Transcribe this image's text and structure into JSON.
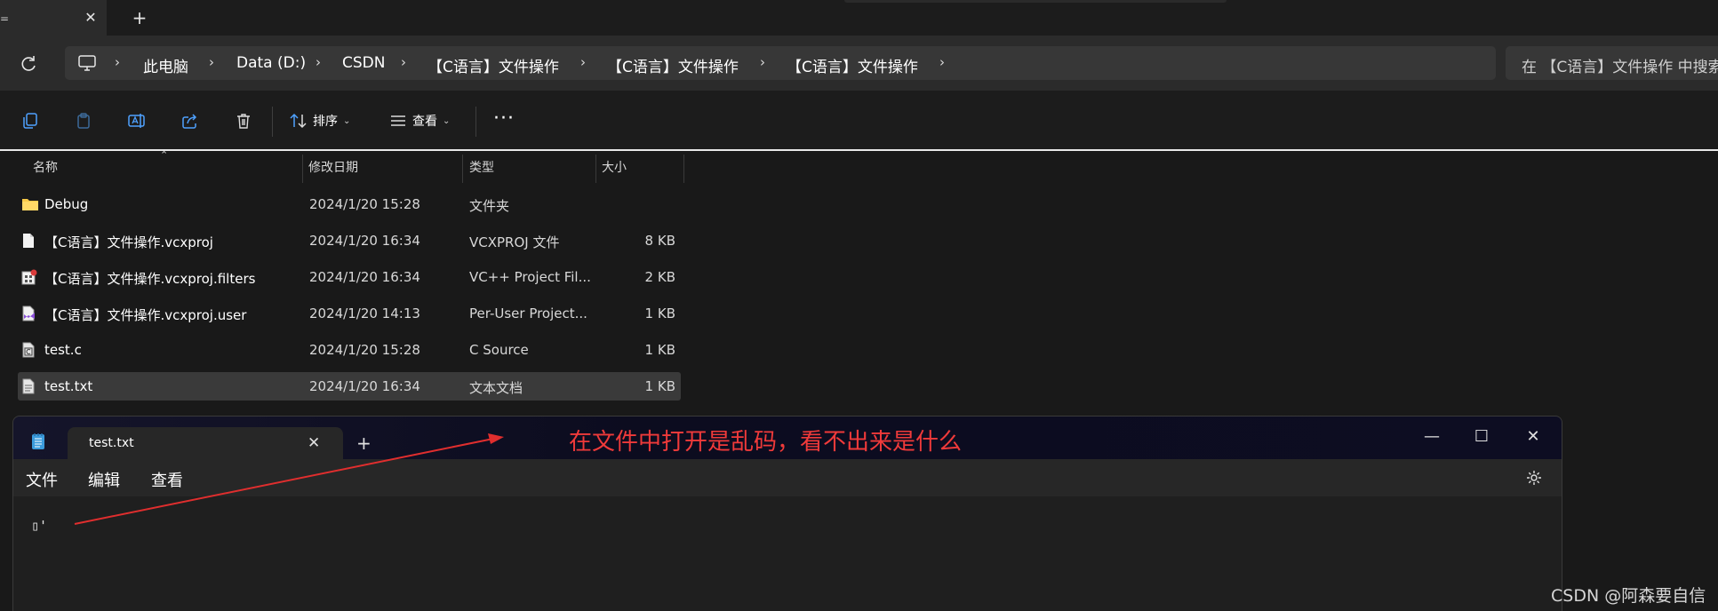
{
  "tabstrip": {
    "close_glyph": "✕",
    "new_glyph": "+"
  },
  "address": {
    "crumbs": [
      "此电脑",
      "Data (D:)",
      "CSDN",
      "【C语言】文件操作",
      "【C语言】文件操作",
      "【C语言】文件操作"
    ],
    "search_text": "在 【C语言】文件操作 中搜索"
  },
  "commandbar": {
    "sort_label": "排序",
    "view_label": "查看",
    "more_glyph": "···"
  },
  "filelist": {
    "columns": [
      "名称",
      "修改日期",
      "类型",
      "大小"
    ],
    "rows": [
      {
        "name": "Debug",
        "date": "2024/1/20 15:28",
        "type": "文件夹",
        "size": "",
        "icon": "folder-icon"
      },
      {
        "name": "【C语言】文件操作.vcxproj",
        "date": "2024/1/20 16:34",
        "type": "VCXPROJ 文件",
        "size": "8 KB",
        "icon": "file-icon"
      },
      {
        "name": "【C语言】文件操作.vcxproj.filters",
        "date": "2024/1/20 16:34",
        "type": "VC++ Project Fil...",
        "size": "2 KB",
        "icon": "filters-file-icon"
      },
      {
        "name": "【C语言】文件操作.vcxproj.user",
        "date": "2024/1/20 14:13",
        "type": "Per-User Project...",
        "size": "1 KB",
        "icon": "user-file-icon"
      },
      {
        "name": "test.c",
        "date": "2024/1/20 15:28",
        "type": "C Source",
        "size": "1 KB",
        "icon": "c-source-icon"
      },
      {
        "name": "test.txt",
        "date": "2024/1/20 16:34",
        "type": "文本文档",
        "size": "1 KB",
        "icon": "text-file-icon"
      }
    ]
  },
  "notepad": {
    "tab_title": "test.txt",
    "menu": [
      "文件",
      "编辑",
      "查看"
    ],
    "content": "▯'",
    "annotation": "在文件中打开是乱码，看不出来是什么"
  },
  "watermark": "CSDN @阿森要自信",
  "colors": {
    "annotation": "#f03a3a",
    "accent": "#4ea1ff",
    "folder": "#f7c948"
  }
}
